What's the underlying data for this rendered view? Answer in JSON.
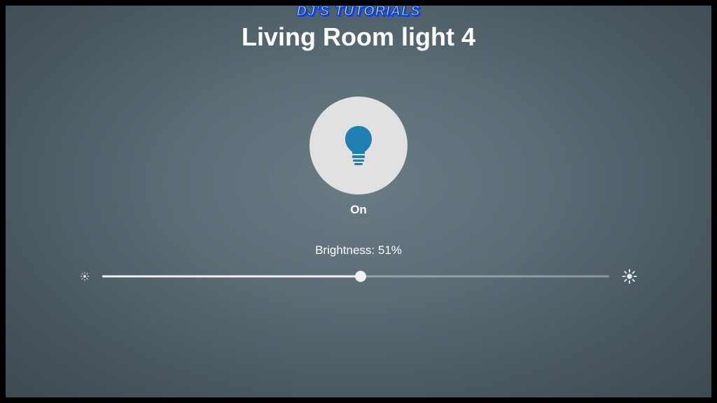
{
  "watermark": "DJ'S TUTORIALS",
  "title": "Living Room light 4",
  "power": {
    "status_label": "On"
  },
  "brightness": {
    "label_prefix": "Brightness: ",
    "value": 51,
    "label_suffix": "%"
  },
  "icons": {
    "bulb": "bulb-icon",
    "sun_small": "sun-dim-icon",
    "sun_large": "sun-bright-icon"
  },
  "colors": {
    "accent": "#1f7fb0",
    "button_bg": "#e1e1e1"
  }
}
